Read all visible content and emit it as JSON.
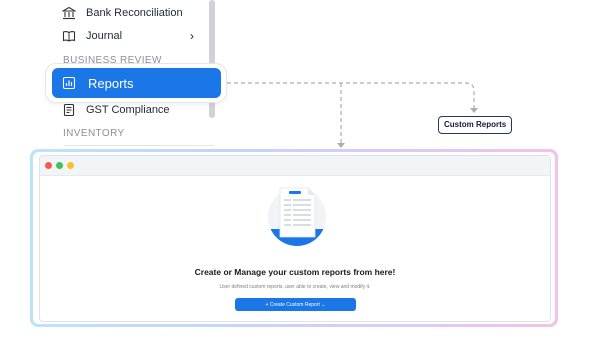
{
  "sidebar": {
    "items": [
      {
        "label": "Bank Reconciliation",
        "icon": "bank-icon"
      },
      {
        "label": "Journal",
        "icon": "book-icon",
        "chevron": "›"
      }
    ],
    "section_business_review": "BUSINESS REVIEW",
    "reports": {
      "label": "Reports",
      "icon": "bar-chart-icon",
      "selected": true
    },
    "gst": {
      "label": "GST Compliance",
      "icon": "receipt-icon"
    },
    "section_inventory": "INVENTORY"
  },
  "callout": {
    "label": "Custom Reports"
  },
  "window": {
    "headline": "Create or Manage your custom reports from here!",
    "subtext": "User defined custom reports, user able to create, view and modify it.",
    "button_label": "+ Create Custom Report ⌄"
  },
  "colors": {
    "accent": "#1b76e8",
    "dot_red": "#f25c55",
    "dot_green": "#3fc353",
    "dot_yellow": "#f7c12f"
  }
}
